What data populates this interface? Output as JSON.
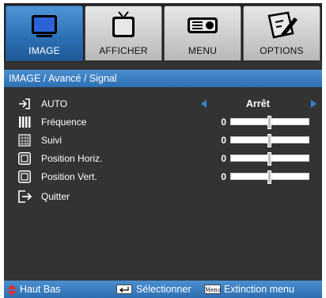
{
  "tabs": [
    {
      "label": "IMAGE",
      "icon": "monitor-icon",
      "active": true
    },
    {
      "label": "AFFICHER",
      "icon": "tv-icon",
      "active": false
    },
    {
      "label": "MENU",
      "icon": "projector-icon",
      "active": false
    },
    {
      "label": "OPTIONS",
      "icon": "settings-pencil-icon",
      "active": false
    }
  ],
  "breadcrumb": "IMAGE / Avancé / Signal",
  "rows": {
    "auto": {
      "label": "AUTO",
      "value": "Arrêt",
      "icon": "enter-icon"
    },
    "frequence": {
      "label": "Fréquence",
      "value": "0",
      "icon": "bars-icon",
      "level": 0.5
    },
    "suivi": {
      "label": "Suivi",
      "value": "0",
      "icon": "grid-icon",
      "level": 0.5
    },
    "position_horiz": {
      "label": "Position Horiz.",
      "value": "0",
      "icon": "frame-icon",
      "level": 0.5
    },
    "position_vert": {
      "label": "Position Vert.",
      "value": "0",
      "icon": "frame-icon",
      "level": 0.5
    },
    "quitter": {
      "label": "Quitter",
      "icon": "exit-icon"
    }
  },
  "footer": {
    "updown_label": "Haut Bas",
    "select_label": "Sélectionner",
    "menu_key": "Menu",
    "exit_label": "Extinction menu"
  },
  "colors": {
    "accent": "#2c6fb2",
    "active_tab": "#2b6fb3",
    "background": "#333333",
    "arrow": "#2f84d6",
    "updown_arrow": "#e0302c"
  }
}
